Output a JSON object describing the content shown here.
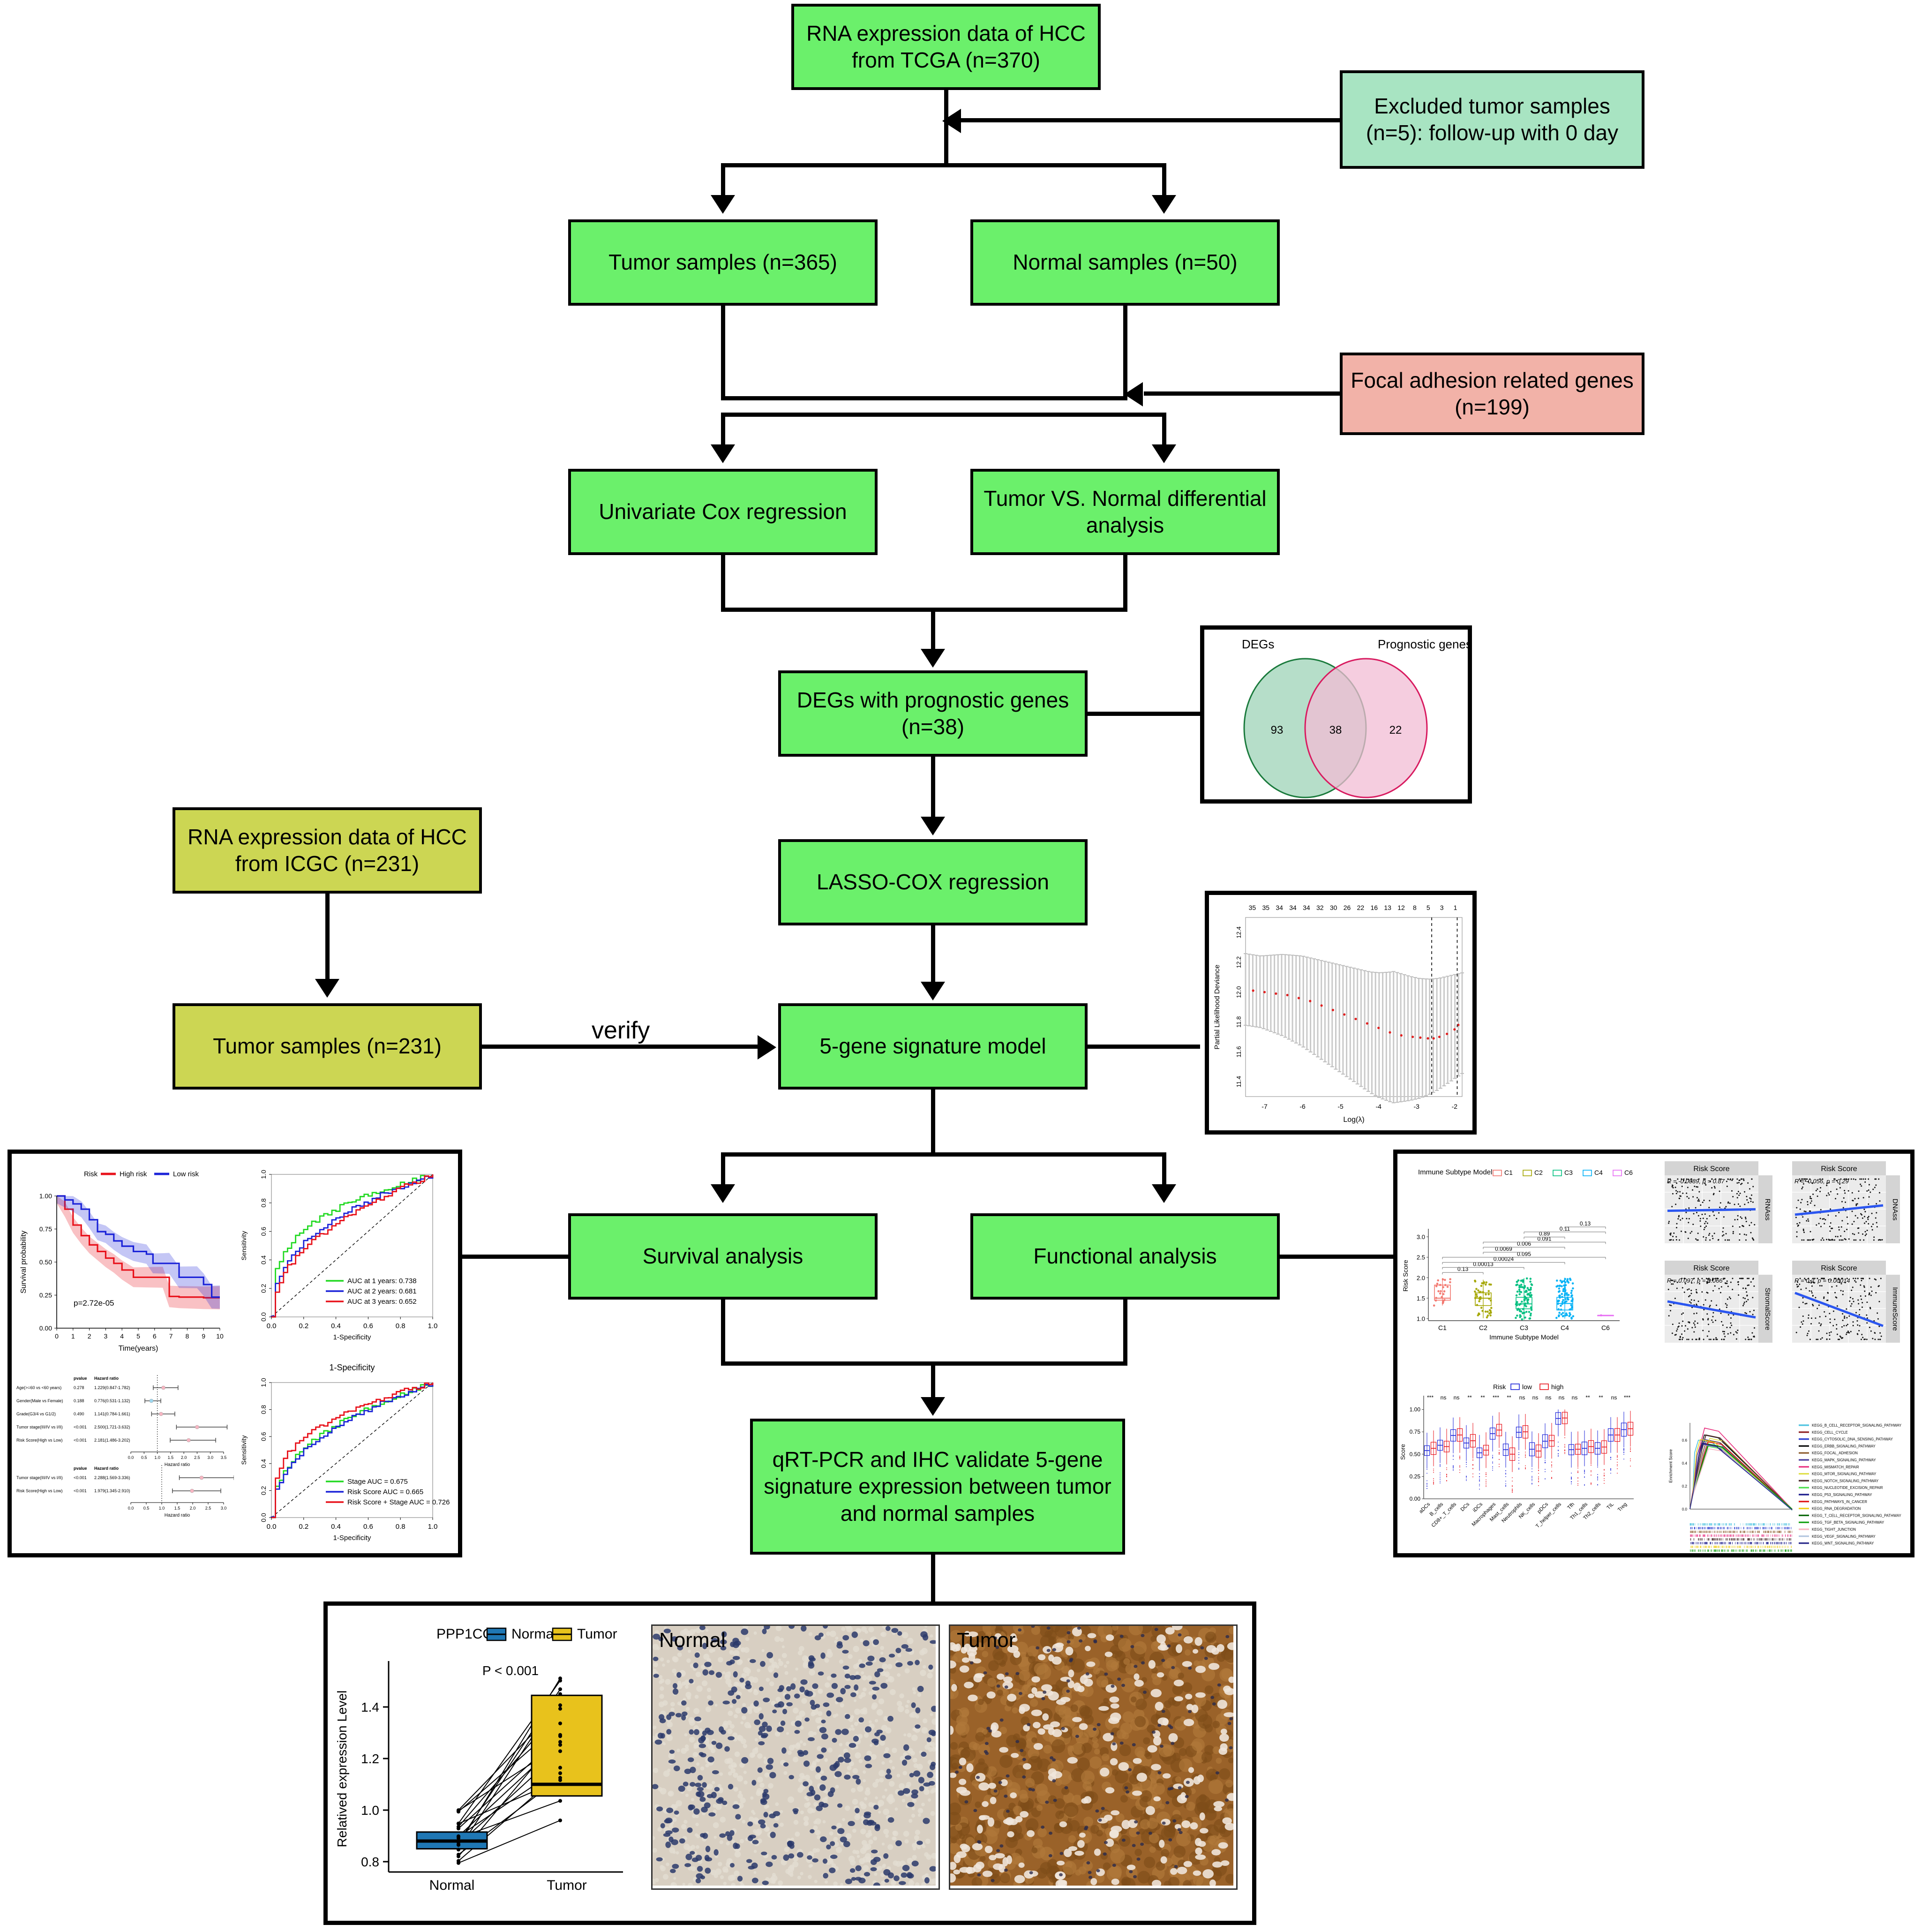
{
  "flow": {
    "n1": "RNA expression data of HCC from TCGA (n=370)",
    "n2": "Excluded tumor samples (n=5): follow-up with 0 day",
    "n3": "Tumor samples (n=365)",
    "n4": "Normal samples (n=50)",
    "n5": "Focal adhesion related genes (n=199)",
    "n6": "Univariate Cox regression",
    "n7": "Tumor VS. Normal differential analysis",
    "n8": "DEGs with prognostic genes (n=38)",
    "n9": "LASSO-COX regression",
    "n10": "RNA expression data of HCC from ICGC (n=231)",
    "n11": "Tumor samples (n=231)",
    "n12": "5-gene signature model",
    "n13": "Survival analysis",
    "n14": "Functional analysis",
    "n15": "qRT-PCR and IHC validate 5-gene signature expression between tumor and normal samples",
    "verify_label": "verify"
  },
  "colors": {
    "green": "#6bf06b",
    "mint": "#a8e4c2",
    "salmon": "#f2b2a8",
    "olive": "#ccd653",
    "high_risk": "#e8111a",
    "low_risk": "#1a22d8",
    "normal_blue": "#1f77b4",
    "tumor_gold": "#e8c21c"
  },
  "chart_data": [
    {
      "id": "venn",
      "type": "venn",
      "title": "",
      "sets": [
        "DEGs",
        "Prognostic genes"
      ],
      "only_left": 93,
      "overlap": 38,
      "only_right": 22,
      "left_color": "#a9d8c0",
      "right_color": "#f2bcd4"
    },
    {
      "id": "lasso",
      "type": "line",
      "title": "",
      "xlabel": "Log(λ)",
      "ylabel": "Partial Likelihood Deviance",
      "top_axis_labels": [
        "35",
        "35",
        "34",
        "34",
        "34",
        "32",
        "30",
        "26",
        "22",
        "16",
        "13",
        "12",
        "8",
        "5",
        "3",
        "1"
      ],
      "xticks": [
        "-7",
        "-6",
        "-5",
        "-4",
        "-3",
        "-2"
      ],
      "yticks": [
        "11.4",
        "11.6",
        "11.8",
        "12.0",
        "12.2",
        "12.4"
      ],
      "xlim": [
        -7.5,
        -1.8
      ],
      "ylim": [
        11.3,
        12.5
      ],
      "x": [
        -7.3,
        -7.0,
        -6.7,
        -6.4,
        -6.1,
        -5.8,
        -5.5,
        -5.2,
        -4.9,
        -4.6,
        -4.3,
        -4.0,
        -3.7,
        -3.4,
        -3.1,
        -2.9,
        -2.7,
        -2.55,
        -2.4,
        -2.2,
        -2.0,
        -1.9
      ],
      "mean": [
        12.01,
        12.0,
        11.99,
        11.98,
        11.96,
        11.94,
        11.91,
        11.88,
        11.85,
        11.82,
        11.79,
        11.76,
        11.73,
        11.71,
        11.7,
        11.695,
        11.69,
        11.69,
        11.7,
        11.72,
        11.75,
        11.78
      ],
      "vlines": [
        -2.6,
        -1.93
      ],
      "grid": false
    },
    {
      "id": "km",
      "type": "line",
      "title": "",
      "legend_title": "Risk",
      "legend": [
        "High risk",
        "Low risk"
      ],
      "xlabel": "Time(years)",
      "ylabel": "Survival probability",
      "annotation": "p=2.72e-05",
      "xticks": [
        "0",
        "1",
        "2",
        "3",
        "4",
        "5",
        "6",
        "7",
        "8",
        "9",
        "10"
      ],
      "yticks": [
        "0.00",
        "0.25",
        "0.50",
        "0.75",
        "1.00"
      ],
      "xlim": [
        0,
        10
      ],
      "ylim": [
        0,
        1
      ],
      "series": [
        {
          "name": "High risk",
          "color": "#e8111a",
          "x": [
            0,
            0.5,
            1,
            1.5,
            2,
            2.5,
            3,
            3.5,
            4,
            4.7,
            5.5,
            6.5,
            6.9,
            7.5,
            9,
            10
          ],
          "y": [
            1.0,
            0.9,
            0.78,
            0.7,
            0.63,
            0.58,
            0.53,
            0.49,
            0.44,
            0.385,
            0.385,
            0.385,
            0.24,
            0.235,
            0.23,
            0.23
          ]
        },
        {
          "name": "Low risk",
          "color": "#1a22d8",
          "x": [
            0,
            0.5,
            1,
            1.5,
            2,
            2.5,
            3,
            3.5,
            4,
            4.7,
            5.5,
            5.9,
            6.5,
            6.9,
            7.5,
            8.6,
            9,
            9.5,
            10
          ],
          "y": [
            1.0,
            0.97,
            0.94,
            0.9,
            0.82,
            0.73,
            0.71,
            0.66,
            0.62,
            0.58,
            0.56,
            0.49,
            0.49,
            0.49,
            0.385,
            0.385,
            0.33,
            0.235,
            0.235
          ]
        }
      ]
    },
    {
      "id": "roc_years",
      "type": "line",
      "title": "",
      "xlabel": "1-Specificity",
      "ylabel": "Sensitivity",
      "xticks": [
        "0.0",
        "0.2",
        "0.4",
        "0.6",
        "0.8",
        "1.0"
      ],
      "yticks": [
        "0.0",
        "0.2",
        "0.4",
        "0.6",
        "0.8",
        "1.0"
      ],
      "legend": [
        "AUC at 1 years: 0.738",
        "AUC at 2 years: 0.681",
        "AUC at 3 years: 0.652"
      ],
      "legend_colors": [
        "#21d921",
        "#1a22d8",
        "#e8111a"
      ],
      "series": [
        {
          "name": "AUC at 1 years: 0.738",
          "color": "#21d921",
          "auc": 0.738
        },
        {
          "name": "AUC at 2 years: 0.681",
          "color": "#1a22d8",
          "auc": 0.681
        },
        {
          "name": "AUC at 3 years: 0.652",
          "color": "#e8111a",
          "auc": 0.652
        }
      ]
    },
    {
      "id": "roc_stage",
      "type": "line",
      "title": "1-Specificity",
      "xlabel": "1-Specificity",
      "ylabel": "Sensitivity",
      "xticks": [
        "0.0",
        "0.2",
        "0.4",
        "0.6",
        "0.8",
        "1.0"
      ],
      "yticks": [
        "0.0",
        "0.2",
        "0.4",
        "0.6",
        "0.8",
        "1.0"
      ],
      "legend": [
        "Stage AUC = 0.675",
        "Risk Score AUC = 0.665",
        "Risk Score + Stage AUC = 0.726"
      ],
      "legend_colors": [
        "#21d921",
        "#1a22d8",
        "#e8111a"
      ],
      "series": [
        {
          "name": "Stage AUC = 0.675",
          "color": "#21d921",
          "auc": 0.675
        },
        {
          "name": "Risk Score AUC = 0.665",
          "color": "#1a22d8",
          "auc": 0.665
        },
        {
          "name": "Risk Score + Stage AUC = 0.726",
          "color": "#e8111a",
          "auc": 0.726
        }
      ]
    },
    {
      "id": "forest_uni",
      "type": "table",
      "columns": [
        "",
        "pvalue",
        "Hazard ratio"
      ],
      "xlabel": "Hazard ratio",
      "xticks": [
        "0.0",
        "0.5",
        "1.0",
        "1.5",
        "2.0",
        "2.5",
        "3.0",
        "3.5"
      ],
      "rows": [
        {
          "label": "Age(>=60 vs <60 years)",
          "pvalue": "0.278",
          "hr": "1.229(0.847-1.782)",
          "est": 1.229,
          "lo": 0.847,
          "hi": 1.782,
          "color": "#f7b6c2"
        },
        {
          "label": "Gender(Male vs Female)",
          "pvalue": "0.188",
          "hr": "0.776(0.531-1.132)",
          "est": 0.776,
          "lo": 0.531,
          "hi": 1.132,
          "color": "#9fd8f0"
        },
        {
          "label": "Grade(G3/4 vs G1/2)",
          "pvalue": "0.490",
          "hr": "1.141(0.784-1.661)",
          "est": 1.141,
          "lo": 0.784,
          "hi": 1.661,
          "color": "#f7b6c2"
        },
        {
          "label": "Tumor stage(III/IV vs I/II)",
          "pvalue": "<0.001",
          "hr": "2.500(1.721-3.632)",
          "est": 2.5,
          "lo": 1.721,
          "hi": 3.632,
          "color": "#f7b6c2"
        },
        {
          "label": "Risk Score(High vs Low)",
          "pvalue": "<0.001",
          "hr": "2.181(1.486-3.202)",
          "est": 2.181,
          "lo": 1.486,
          "hi": 3.202,
          "color": "#f7b6c2"
        }
      ]
    },
    {
      "id": "forest_multi",
      "type": "table",
      "columns": [
        "",
        "pvalue",
        "Hazard ratio"
      ],
      "xlabel": "Hazard ratio",
      "xticks": [
        "0.0",
        "0.5",
        "1.0",
        "1.5",
        "2.0",
        "2.5",
        "3.0"
      ],
      "rows": [
        {
          "label": "Tumor stage(III/IV vs I/II)",
          "pvalue": "<0.001",
          "hr": "2.288(1.569-3.336)",
          "est": 2.288,
          "lo": 1.569,
          "hi": 3.336,
          "color": "#f7b6c2"
        },
        {
          "label": "Risk Score(High vs Low)",
          "pvalue": "<0.001",
          "hr": "1.979(1.345-2.910)",
          "est": 1.979,
          "lo": 1.345,
          "hi": 2.91,
          "color": "#f7b6c2"
        }
      ]
    },
    {
      "id": "immune_subtype",
      "type": "box",
      "legend_title": "Immune Subtype Model",
      "categories": [
        "C1",
        "C2",
        "C3",
        "C4",
        "C6"
      ],
      "colors": [
        "#f2766d",
        "#a3a500",
        "#00b f7f",
        "#00b0f6",
        "#e76bf3"
      ],
      "xlabel": "Immune Subtype Model",
      "ylabel": "Risk Score",
      "yticks": [
        "1.0",
        "1.5",
        "2.0",
        "2.5",
        "3.0"
      ],
      "ylim": [
        0.95,
        3.15
      ],
      "boxes": [
        {
          "cat": "C1",
          "q1": 1.45,
          "med": 1.5,
          "q3": 1.82,
          "lo": 1.32,
          "hi": 1.99
        },
        {
          "cat": "C2",
          "q1": 1.32,
          "med": 1.5,
          "q3": 1.63,
          "lo": 1.01,
          "hi": 1.95
        },
        {
          "cat": "C3",
          "q1": 1.24,
          "med": 1.36,
          "q3": 1.52,
          "lo": 0.97,
          "hi": 1.99
        },
        {
          "cat": "C4",
          "q1": 1.21,
          "med": 1.37,
          "q3": 1.52,
          "lo": 1.0,
          "hi": 2.0
        },
        {
          "cat": "C6",
          "q1": 1.08,
          "med": 1.08,
          "q3": 1.08,
          "lo": 1.08,
          "hi": 1.08
        }
      ],
      "pvalues": [
        "0.13",
        "0.00013",
        "0.00024",
        "0.095",
        "0.0069",
        "0.006",
        "0.091",
        "0.89",
        "0.11",
        "0.13"
      ]
    },
    {
      "id": "corr_panels",
      "type": "scatter",
      "panels": [
        {
          "top": "Risk Score",
          "right": "RNAss",
          "annotation": "R = -0.0089, p = 0.87",
          "slope": -0.0089,
          "p": 0.87
        },
        {
          "top": "Risk Score",
          "right": "DNAss",
          "annotation": "R = -0.056, p = 0.29",
          "slope": -0.056,
          "p": 0.29
        },
        {
          "top": "Risk Score",
          "right": "StromalScore",
          "annotation": "R = 0.097, p = 0.066",
          "slope": 0.097,
          "p": 0.066
        },
        {
          "top": "Risk Score",
          "right": "ImmuneScore",
          "annotation": "R = 0.2, p = 0.00014",
          "slope": 0.2,
          "p": 0.00014
        }
      ]
    },
    {
      "id": "immune_cells",
      "type": "box",
      "legend_title": "Risk",
      "legend": [
        "low",
        "high"
      ],
      "legend_colors": [
        "#1a22d8",
        "#e8111a"
      ],
      "ylabel": "Score",
      "yticks": [
        "0.00",
        "0.25",
        "0.50",
        "0.75",
        "1.00"
      ],
      "ylim": [
        0,
        1.05
      ],
      "categories": [
        "aDCs",
        "B_cells",
        "CD8+_T_cells",
        "DCs",
        "iDCs",
        "Macrophages",
        "Mast_cells",
        "Neutrophils",
        "NK_cells",
        "pDCs",
        "T_helper_cells",
        "Tfh",
        "Th1_cells",
        "Th2_cells",
        "TIL",
        "Treg"
      ],
      "significance": [
        "***",
        "ns",
        "ns",
        "**",
        "**",
        "***",
        "**",
        "ns",
        "ns",
        "ns",
        "ns",
        "ns",
        "**",
        "**",
        "ns",
        "***"
      ],
      "series": [
        {
          "name": "low",
          "color": "#1a22d8",
          "med": [
            0.54,
            0.6,
            0.71,
            0.625,
            0.515,
            0.73,
            0.55,
            0.745,
            0.555,
            0.645,
            0.9,
            0.55,
            0.565,
            0.565,
            0.715,
            0.775
          ]
        },
        {
          "name": "high",
          "color": "#e8111a",
          "med": [
            0.565,
            0.585,
            0.715,
            0.65,
            0.545,
            0.77,
            0.5,
            0.75,
            0.535,
            0.65,
            0.905,
            0.555,
            0.585,
            0.58,
            0.715,
            0.785
          ]
        }
      ]
    },
    {
      "id": "gsea",
      "type": "line",
      "ylabel": "Enrichment Score",
      "yticks": [
        "0.0",
        "0.2",
        "0.4",
        "0.6"
      ],
      "legend": [
        "KEGG_B_CELL_RECEPTOR_SIGNALING_PATHWAY",
        "KEGG_CELL_CYCLE",
        "KEGG_CYTOSOLIC_DNA_SENSING_PATHWAY",
        "KEGG_ERBB_SIGNALING_PATHWAY",
        "KEGG_FOCAL_ADHESION",
        "KEGG_MAPK_SIGNALING_PATHWAY",
        "KEGG_MISMATCH_REPAIR",
        "KEGG_MTOR_SIGNALING_PATHWAY",
        "KEGG_NOTCH_SIGNALING_PATHWAY",
        "KEGG_NUCLEOTIDE_EXCISION_REPAIR",
        "KEGG_P53_SIGNALING_PATHWAY",
        "KEGG_PATHWAYS_IN_CANCER",
        "KEGG_RNA_DEGRADATION",
        "KEGG_T_CELL_RECEPTOR_SIGNALING_PATHWAY",
        "KEGG_TGF_BETA_SIGNALING_PATHWAY",
        "KEGG_TIGHT_JUNCTION",
        "KEGG_VEGF_SIGNALING_PATHWAY",
        "KEGG_WNT_SIGNALING_PATHWAY"
      ],
      "legend_colors": [
        "#4ec3e0",
        "#8b1a1a",
        "#2b3fd0",
        "#111111",
        "#8b5a2b",
        "#4a3f9e",
        "#e8307f",
        "#e0e04a",
        "#4a2b2b",
        "#4ade4a",
        "#1a1a8b",
        "#e01010",
        "#f0d020",
        "#106b10",
        "#10a010",
        "#f7b6c2",
        "#b0c4de",
        "#2a2a8b"
      ],
      "peaks": [
        0.6,
        0.645,
        0.605,
        0.645,
        0.6,
        0.575,
        0.705,
        0.615,
        0.645,
        0.545,
        0.575,
        0.585,
        0.605,
        0.565,
        0.555,
        0.525,
        0.555,
        0.565
      ]
    },
    {
      "id": "pcr",
      "type": "box",
      "legend_title": "PPP1CC",
      "legend": [
        "Normal",
        "Tumor"
      ],
      "legend_colors": [
        "#1f77b4",
        "#e8c21c"
      ],
      "annotation": "P < 0.001",
      "ylabel": "Relatived expression Level",
      "categories": [
        "Normal",
        "Tumor"
      ],
      "yticks": [
        "0.8",
        "1.0",
        "1.2",
        "1.4"
      ],
      "ylim": [
        0.76,
        1.56
      ],
      "boxes": [
        {
          "cat": "Normal",
          "q1": 0.85,
          "med": 0.88,
          "q3": 0.915,
          "color": "#1f77b4"
        },
        {
          "cat": "Tumor",
          "q1": 1.055,
          "med": 1.1,
          "q3": 1.445,
          "color": "#e8c21c"
        }
      ]
    }
  ],
  "ihc": {
    "normal_label": "Normal",
    "tumor_label": "Tumor"
  }
}
